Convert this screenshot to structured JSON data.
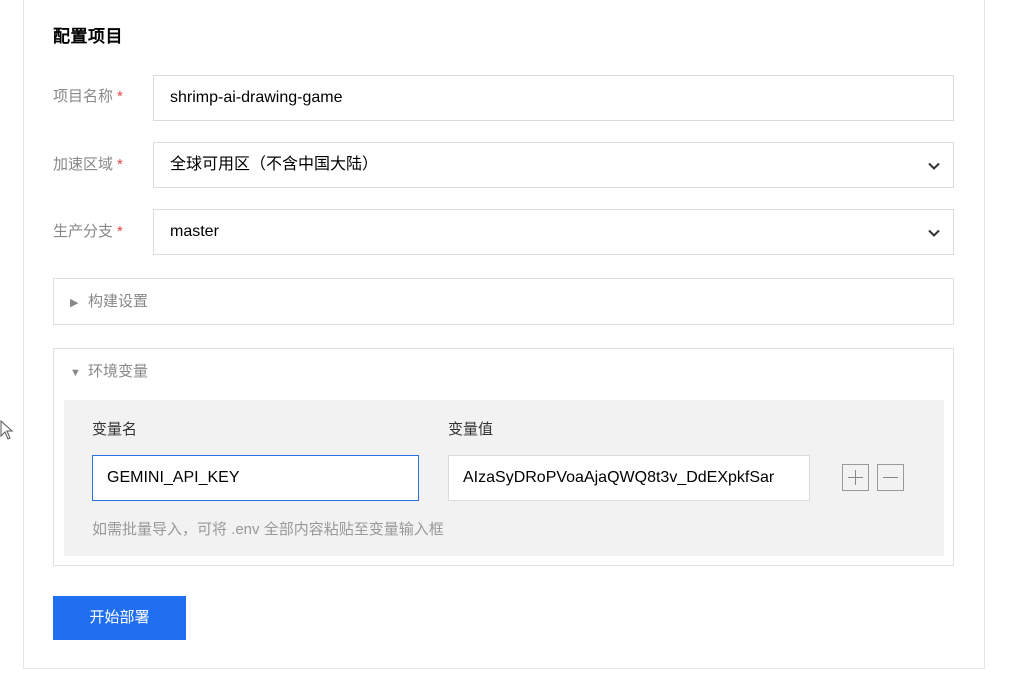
{
  "section": {
    "title": "配置项目"
  },
  "fields": {
    "project_name": {
      "label": "项目名称",
      "required_mark": "*",
      "value": "shrimp-ai-drawing-game"
    },
    "region": {
      "label": "加速区域",
      "required_mark": "*",
      "value": "全球可用区（不含中国大陆）"
    },
    "branch": {
      "label": "生产分支",
      "required_mark": "*",
      "value": "master"
    }
  },
  "build_settings": {
    "label": "构建设置",
    "expanded": false
  },
  "env_vars": {
    "label": "环境变量",
    "expanded": true,
    "name_header": "变量名",
    "value_header": "变量值",
    "rows": [
      {
        "name": "GEMINI_API_KEY",
        "value": "AIzaSyDRoPVoaAjaQWQ8t3v_DdEXpkfSar"
      }
    ],
    "hint": "如需批量导入，可将 .env 全部内容粘贴至变量输入框"
  },
  "actions": {
    "deploy_label": "开始部署"
  },
  "icons": {
    "collapsed": "triangle-right-icon",
    "expanded": "triangle-down-icon",
    "dropdown": "chevron-down-icon",
    "add": "plus-square-icon",
    "remove": "minus-square-icon"
  },
  "colors": {
    "primary": "#1f6ff0",
    "required": "#e54545",
    "focus_border": "#2b6fe0"
  }
}
